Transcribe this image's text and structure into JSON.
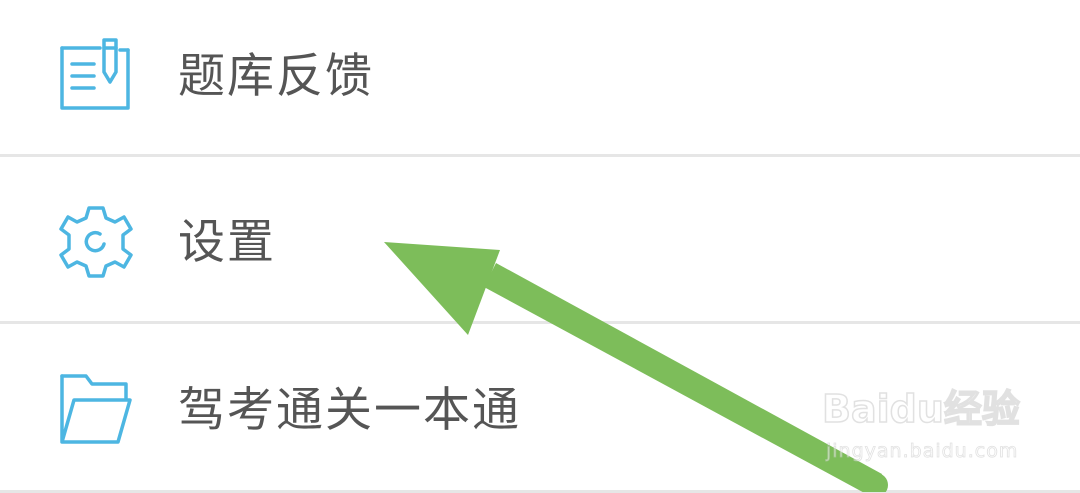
{
  "menu": {
    "items": [
      {
        "label": "题库反馈",
        "icon": "feedback-edit-icon"
      },
      {
        "label": "设置",
        "icon": "gear-icon"
      },
      {
        "label": "驾考通关一本通",
        "icon": "folder-icon"
      }
    ]
  },
  "watermark": {
    "logo_text": "Baidu经验",
    "url": "jingyan.baidu.com"
  },
  "colors": {
    "icon": "#4db6e2",
    "text": "#555555",
    "divider": "#e6e6e6",
    "arrow": "#7dbd5a"
  }
}
